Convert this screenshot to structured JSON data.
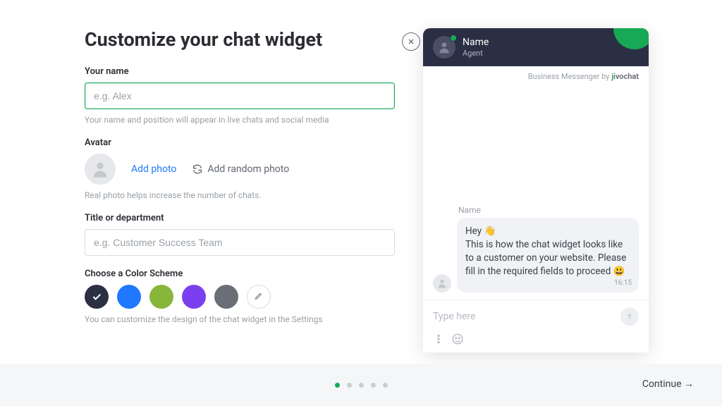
{
  "heading": "Customize your chat widget",
  "name_section": {
    "label": "Your name",
    "placeholder": "e.g. Alex",
    "help": "Your name and position will appear in live chats and social media"
  },
  "avatar_section": {
    "label": "Avatar",
    "add_photo": "Add photo",
    "add_random": "Add random photo",
    "help": "Real photo helps increase the number of chats."
  },
  "title_section": {
    "label": "Title or department",
    "placeholder": "e.g. Customer Success Team"
  },
  "color_section": {
    "label": "Choose a Color Scheme",
    "help": "You can customize the design of the chat widget in the Settings",
    "swatches": [
      "#2b2f44",
      "#1f78ff",
      "#88b63a",
      "#7b3ff0",
      "#6a6e76"
    ]
  },
  "preview": {
    "header_name": "Name",
    "header_role": "Agent",
    "powered_prefix": "Business Messenger by ",
    "powered_brand": "jivochat",
    "message_sender": "Name",
    "message_text": "Hey 👋\nThis is how the chat widget looks like to a customer on your website. Please fill in the required fields to proceed 😃",
    "message_time": "16:15",
    "input_placeholder": "Type here"
  },
  "footer": {
    "continue": "Continue →"
  }
}
